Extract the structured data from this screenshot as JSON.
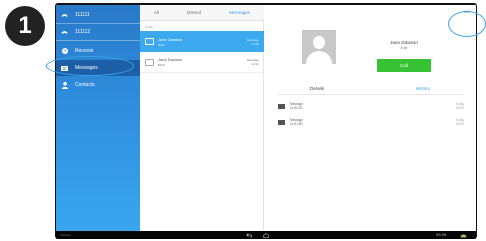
{
  "step_number": "1",
  "sidebar": {
    "items": [
      {
        "label": "111111",
        "icon": "phone-icon"
      },
      {
        "label": "111112",
        "icon": "phone-icon"
      },
      {
        "label": "Recents",
        "icon": "clock-icon"
      },
      {
        "label": "Messages",
        "icon": "message-icon",
        "active": true
      },
      {
        "label": "Contacts",
        "icon": "person-icon"
      }
    ]
  },
  "tabs": {
    "all": "All",
    "missed": "Missed",
    "messages": "Messages",
    "active": "Messages"
  },
  "list": {
    "date_header": "Today",
    "rows": [
      {
        "name": "Jane Dawson",
        "number": "8610",
        "type": "Message",
        "time": "14:32",
        "selected": true
      },
      {
        "name": "Jane Dawson",
        "number": "8610",
        "type": "Message",
        "time": "14:31",
        "selected": false
      }
    ]
  },
  "detail": {
    "menu_glyph": "•••",
    "contact_name": "Jane Dawson",
    "contact_number": "8 sb",
    "call_label": "Call",
    "tab_details": "Details",
    "tab_history": "History",
    "history": [
      {
        "title": "Message",
        "sub": "14:32:30",
        "date": "Today",
        "time": "09:26"
      },
      {
        "title": "Message",
        "sub": "14:31:50",
        "date": "Today",
        "time": "09:26"
      }
    ]
  },
  "navbar": {
    "left_text": "Libernet",
    "clock": "09:26"
  },
  "colors": {
    "accent": "#3aa6ef",
    "call_green": "#37c233",
    "sidebar_active": "#1d5fa6",
    "highlight_ring": "#3aa6ea"
  }
}
